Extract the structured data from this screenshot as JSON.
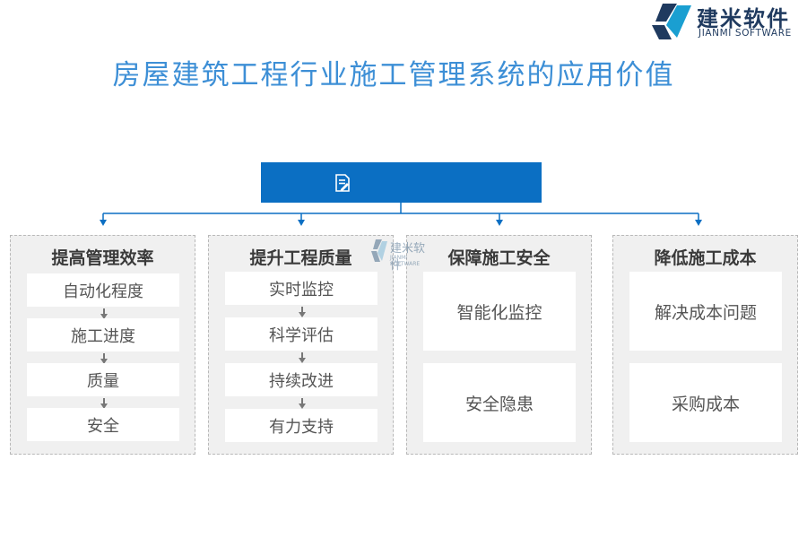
{
  "brand": {
    "name_cn": "建米软件",
    "name_en": "JIANMI SOFTWARE",
    "colors": {
      "dark": "#1f3a5f",
      "accent": "#1a9fd1"
    }
  },
  "title": "房屋建筑工程行业施工管理系统的应用价值",
  "root": {
    "icon": "document-edit-icon",
    "color": "#0b6fc3"
  },
  "watermark": {
    "cn": "建米软件",
    "en": "JIANMI SOFTWARE"
  },
  "columns": [
    {
      "title": "提高管理效率",
      "items": [
        "自动化程度",
        "施工进度",
        "质量",
        "安全"
      ]
    },
    {
      "title": "提升工程质量",
      "items": [
        "实时监控",
        "科学评估",
        "持续改进",
        "有力支持"
      ]
    },
    {
      "title": "保障施工安全",
      "items": [
        "智能化监控",
        "安全隐患"
      ]
    },
    {
      "title": "降低施工成本",
      "items": [
        "解决成本问题",
        "采购成本"
      ]
    }
  ]
}
